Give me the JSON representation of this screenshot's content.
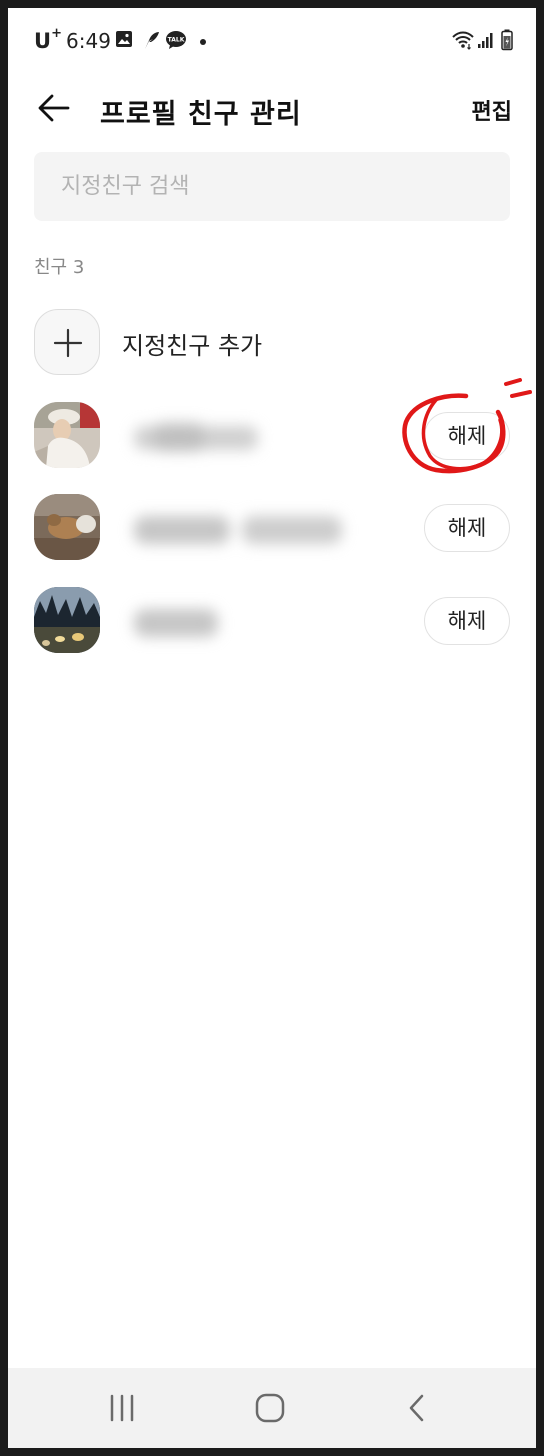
{
  "status_bar": {
    "carrier": "U",
    "carrier_plus": "+",
    "time": "6:49",
    "icons": [
      "gallery-icon",
      "feather-app-icon",
      "kakaotalk-talk-icon",
      "dot-icon",
      "wifi-icon",
      "signal-icon",
      "battery-icon"
    ]
  },
  "header": {
    "title": "프로필 친구 관리",
    "edit_label": "편집"
  },
  "search": {
    "placeholder": "지정친구 검색"
  },
  "list": {
    "count_label": "친구 3",
    "add_label": "지정친구 추가",
    "unlink_label": "해제"
  },
  "colors": {
    "annotation_red": "#e01818",
    "search_bg": "#f4f4f4",
    "navbar_bg": "#f2f2f2"
  }
}
